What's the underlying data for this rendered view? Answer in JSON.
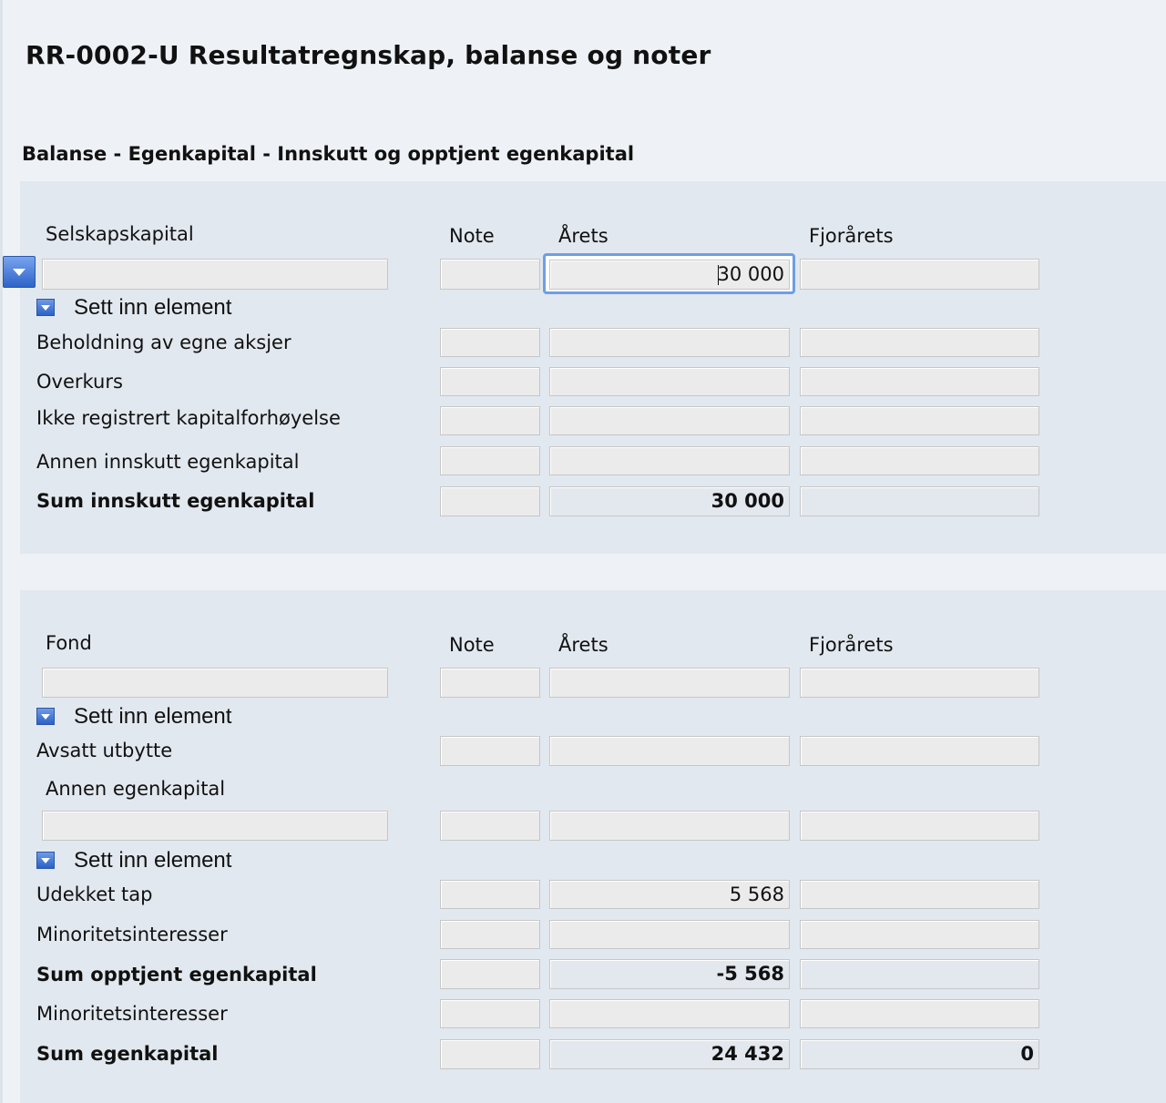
{
  "page": {
    "title": "RR-0002-U Resultatregnskap, balanse og noter",
    "section_title": "Balanse - Egenkapital - Innskutt og opptjent egenkapital"
  },
  "columns": {
    "note": "Note",
    "arets": "Årets",
    "fjorarets": "Fjorårets"
  },
  "insert_label": "Sett inn element",
  "panel1": {
    "group_label": "Selskapskapital",
    "group_row": {
      "arets": "30 000"
    },
    "rows": [
      {
        "label": "Beholdning av egne aksjer"
      },
      {
        "label": "Overkurs"
      },
      {
        "label": "Ikke registrert kapitalforhøyelse"
      },
      {
        "label": "Annen innskutt egenkapital"
      }
    ],
    "sum": {
      "label": "Sum innskutt egenkapital",
      "arets": "30 000",
      "fjorarets": ""
    }
  },
  "panel2": {
    "fond_label": "Fond",
    "avsatt_label": "Avsatt utbytte",
    "annen_label": "Annen egenkapital",
    "udekket": {
      "label": "Udekket tap",
      "arets": "5 568"
    },
    "minoritet1": {
      "label": "Minoritetsinteresser"
    },
    "sum_opptjent": {
      "label": "Sum opptjent egenkapital",
      "arets": "-5 568"
    },
    "minoritet2": {
      "label": "Minoritetsinteresser"
    },
    "sum_egenkapital": {
      "label": "Sum egenkapital",
      "arets": "24 432",
      "fjorarets": "0"
    }
  },
  "icons": {
    "dropdown": "chevron-down-icon"
  },
  "colors": {
    "accent": "#2a62c7",
    "focus": "#6e9ee6",
    "panel": "#e2e8ef",
    "background": "#eef2f6"
  }
}
